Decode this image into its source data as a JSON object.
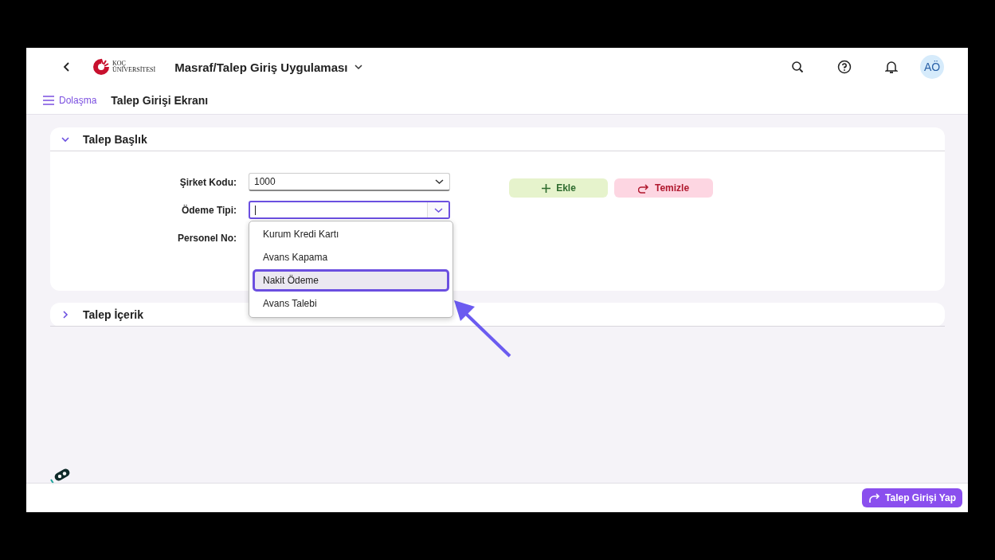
{
  "header": {
    "logo_line1": "KOÇ",
    "logo_line2": "ÜNİVERSİTESİ",
    "app_title": "Masraf/Talep Giriş Uygulaması",
    "avatar": "AÖ"
  },
  "subheader": {
    "nav_label": "Dolaşma",
    "page_title": "Talep Girişi Ekranı"
  },
  "sections": [
    {
      "title": "Talep Başlık",
      "expanded": true
    },
    {
      "title": "Talep İçerik",
      "expanded": false
    }
  ],
  "form": {
    "fields": [
      {
        "label": "Şirket Kodu:",
        "kind": "select",
        "value": "1000",
        "focused": false
      },
      {
        "label": "Ödeme Tipi:",
        "kind": "select",
        "focused": true
      },
      {
        "label": "Personel No:",
        "kind": "covered"
      }
    ],
    "buttons": [
      {
        "label": "Ekle",
        "kind": "add"
      },
      {
        "label": "Temizle",
        "kind": "clear"
      }
    ]
  },
  "dropdown": {
    "items": [
      {
        "label": "Kurum Kredi Kartı",
        "selected": false
      },
      {
        "label": "Avans Kapama",
        "selected": false
      },
      {
        "label": "Nakit Ödeme",
        "selected": true
      },
      {
        "label": "Avans Talebi",
        "selected": false
      }
    ]
  },
  "footer": {
    "button": "Talep Girişi Yap"
  }
}
